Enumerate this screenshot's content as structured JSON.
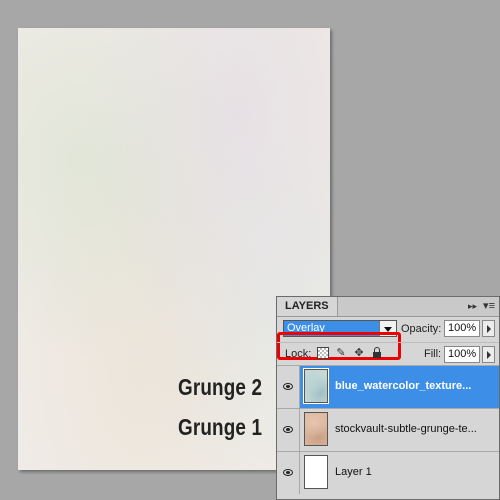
{
  "canvas": {
    "texts": [
      "Grunge 2",
      "Grunge 1"
    ]
  },
  "layers_panel": {
    "tab_label": "LAYERS",
    "collapse_icon": "double-chevron-right-icon",
    "menu_icon": "panel-menu-icon",
    "blend_mode": "Overlay",
    "opacity_label": "Opacity:",
    "opacity_value": "100%",
    "lock_label": "Lock:",
    "lock_icons": [
      "lock-transparent-icon",
      "lock-paint-icon",
      "lock-move-icon",
      "lock-all-icon"
    ],
    "fill_label": "Fill:",
    "fill_value": "100%",
    "layers": [
      {
        "name": "blue_watercolor_texture...",
        "visible": true,
        "selected": true
      },
      {
        "name": "stockvault-subtle-grunge-te...",
        "visible": true,
        "selected": false
      },
      {
        "name": "Layer 1",
        "visible": true,
        "selected": false
      }
    ]
  },
  "colors": {
    "selection": "#3d8ee6",
    "highlight_box": "#e00000",
    "panel_bg": "#d6d6d6",
    "workspace_bg": "#a7a7a7"
  }
}
